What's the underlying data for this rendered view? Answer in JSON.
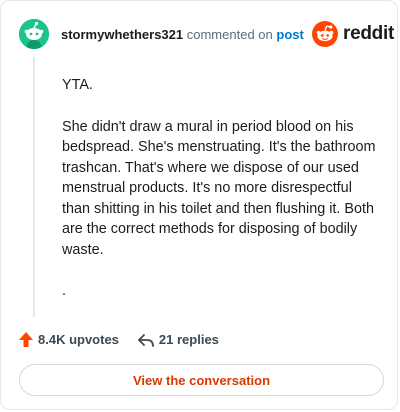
{
  "comment": {
    "username": "stormywhethers321",
    "commented_on_text": "commented on",
    "post_link_label": "post",
    "paragraphs": [
      "YTA.",
      "She didn't draw a mural in period blood on his bedspread. She's menstruating. It's the bathroom trashcan. That's where we dispose of our used menstrual products. It's no more disrespectful than shitting in his toilet and then flushing it. Both are the correct methods for disposing of bodily waste.",
      "."
    ]
  },
  "brand": {
    "wordmark": "reddit",
    "icon": "reddit-snoo-icon",
    "color": "#ff4500"
  },
  "avatar": {
    "icon": "snoo-avatar-icon",
    "color": "#1bc48f"
  },
  "actions": {
    "upvotes_label": "8.4K upvotes",
    "upvote_icon": "upvote-arrow-icon",
    "upvote_color": "#ff4500",
    "replies_label": "21 replies",
    "reply_icon": "reply-arrow-icon"
  },
  "view_button": {
    "label": "View the conversation",
    "color": "#d93a00"
  }
}
